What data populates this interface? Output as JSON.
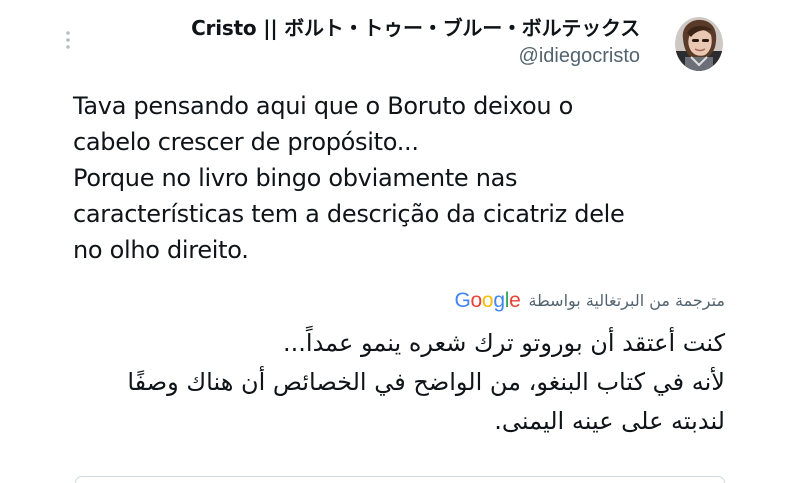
{
  "tweet": {
    "author": {
      "display_name": "Cristo || ボルト・トゥー・ブルー・ボルテックス",
      "handle": "@idiegocristo"
    },
    "text_lines": [
      "Tava pensando aqui que o Boruto deixou o",
      "cabelo crescer de propósito...",
      "Porque no livro bingo obviamente nas",
      "características tem a descrição da cicatriz dele",
      "no olho direito."
    ],
    "translation": {
      "label": "مترجمة من البرتغالية بواسطة",
      "provider": "Google",
      "lines": [
        "كنت أعتقد أن بوروتو ترك شعره ينمو عمداً...",
        "لأنه في كتاب البنغو، من الواضح في الخصائص أن هناك وصفًا",
        "لندبته على عينه اليمنى."
      ]
    }
  },
  "icons": {
    "more": "more-vertical-icon",
    "avatar": "profile-avatar"
  },
  "colors": {
    "text_primary": "#0f1419",
    "text_secondary": "#536471",
    "google_blue": "#4285f4",
    "google_red": "#ea4335",
    "google_yellow": "#fbbc05",
    "google_green": "#34a853"
  }
}
